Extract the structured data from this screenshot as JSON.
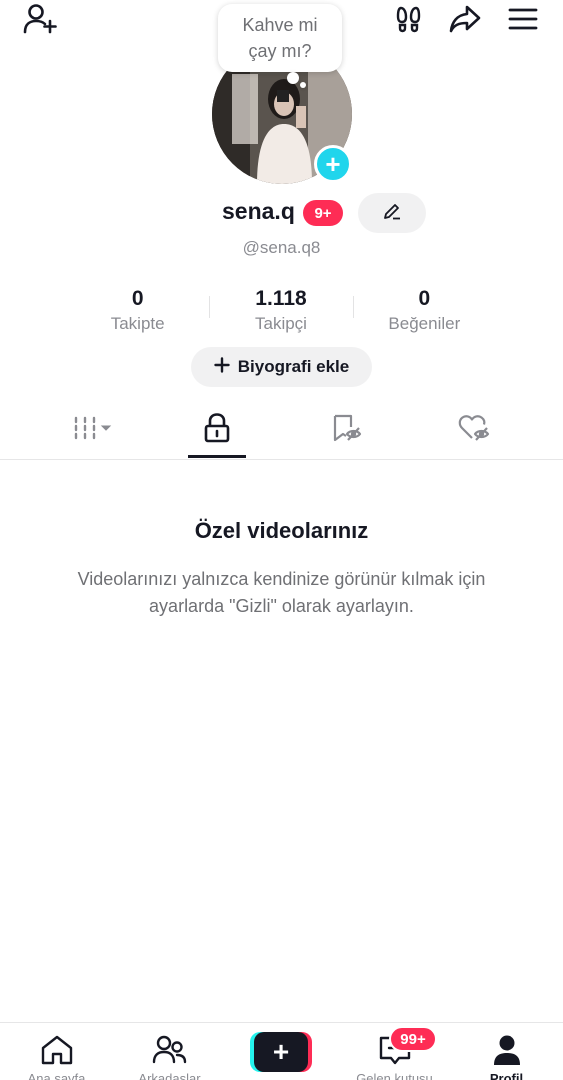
{
  "header": {
    "icons": [
      "add-friend-icon",
      "footprints-icon",
      "share-icon",
      "menu-icon"
    ]
  },
  "bubble": {
    "line1": "Kahve mi",
    "line2": "çay mı?"
  },
  "profile": {
    "username": "sena.q",
    "badge": "9+",
    "handle": "@sena.q8"
  },
  "stats": [
    {
      "value": "0",
      "label": "Takipte"
    },
    {
      "value": "1.118",
      "label": "Takipçi"
    },
    {
      "value": "0",
      "label": "Beğeniler"
    }
  ],
  "bio_button": {
    "label": "Biyografi ekle"
  },
  "tabs": [
    "videos-grid-icon",
    "lock-icon",
    "bookmark-hidden-icon",
    "liked-hidden-icon"
  ],
  "empty_state": {
    "title": "Özel videolarınız",
    "description": "Videolarınızı yalnızca kendinize görünür kılmak için ayarlarda \"Gizli\" olarak ayarlayın."
  },
  "bottom_nav": {
    "items": [
      {
        "label": "Ana sayfa",
        "icon": "home-icon"
      },
      {
        "label": "Arkadaşlar",
        "icon": "friends-icon"
      },
      {
        "label": "",
        "icon": "create-icon"
      },
      {
        "label": "Gelen kutusu",
        "icon": "inbox-icon"
      },
      {
        "label": "Profil",
        "icon": "profile-icon"
      }
    ],
    "inbox_badge": "99+"
  },
  "colors": {
    "accent_pink": "#fe2c55",
    "accent_cyan": "#20d5ec",
    "text_primary": "#161823",
    "text_secondary": "#8a8b91"
  }
}
